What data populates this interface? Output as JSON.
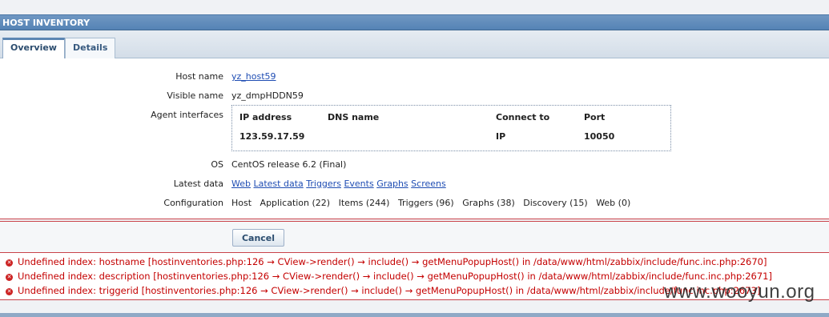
{
  "header": {
    "title": "HOST INVENTORY"
  },
  "tabs": [
    {
      "label": "Overview",
      "active": true
    },
    {
      "label": "Details",
      "active": false
    }
  ],
  "host": {
    "host_name_label": "Host name",
    "host_name_value": "yz_host59",
    "visible_name_label": "Visible name",
    "visible_name_value": "yz_dmpHDDN59",
    "agent_interfaces_label": "Agent interfaces",
    "interfaces": {
      "headers": [
        "IP address",
        "DNS name",
        "Connect to",
        "Port"
      ],
      "rows": [
        {
          "ip": "123.59.17.59",
          "dns": "",
          "connect_to": "IP",
          "port": "10050"
        }
      ]
    },
    "os_label": "OS",
    "os_value": "CentOS release 6.2 (Final)",
    "latest_data_label": "Latest data",
    "latest_data_links": [
      "Web",
      "Latest data",
      "Triggers",
      "Events",
      "Graphs",
      "Screens"
    ],
    "configuration_label": "Configuration",
    "configuration_items": [
      "Host",
      "Application (22)",
      "Items (244)",
      "Triggers (96)",
      "Graphs (38)",
      "Discovery (15)",
      "Web (0)"
    ]
  },
  "footer": {
    "cancel_label": "Cancel"
  },
  "errors": [
    "Undefined index: hostname [hostinventories.php:126 → CView->render() → include() → getMenuPopupHost() in /data/www/html/zabbix/include/func.inc.php:2670]",
    "Undefined index: description [hostinventories.php:126 → CView->render() → include() → getMenuPopupHost() in /data/www/html/zabbix/include/func.inc.php:2671]",
    "Undefined index: triggerid [hostinventories.php:126 → CView->render() → include() → getMenuPopupHost() in /data/www/html/zabbix/include/func.inc.php:2673]"
  ],
  "watermark": "www.wooyun.org",
  "colors": {
    "accent": "#5583b5",
    "error": "#c40000",
    "link": "#1f4db3"
  }
}
